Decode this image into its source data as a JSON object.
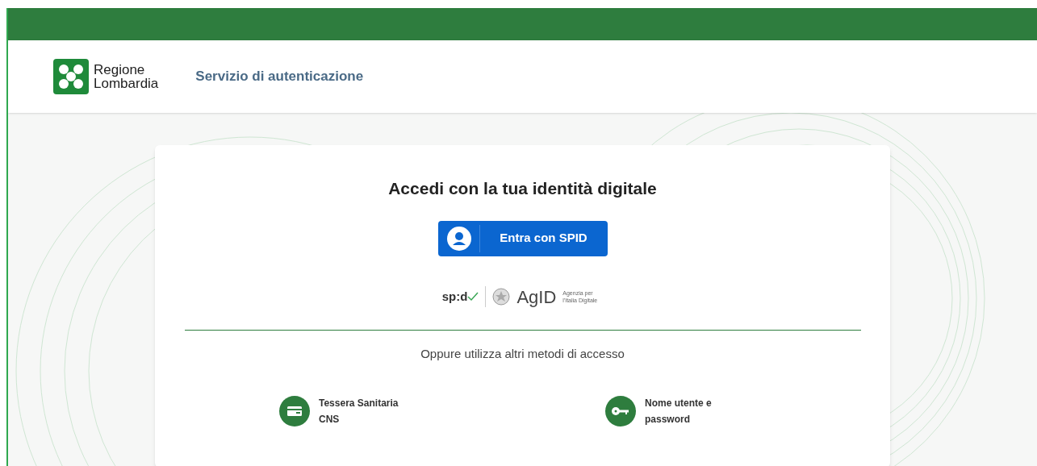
{
  "header": {
    "logo_text": [
      "Regione",
      "Lombardia"
    ],
    "service_title": "Servizio di autenticazione"
  },
  "card": {
    "title": "Accedi con la tua identità digitale",
    "spid_button": "Entra con SPID",
    "partner_logos": {
      "spid": "sp:d",
      "agid": "AgID",
      "agid_caption": "Agenzia per l'Italia Digitale"
    },
    "divider_text": "Oppure utilizza altri metodi di accesso",
    "methods": [
      {
        "kind": "card",
        "label": "Tessera Sanitaria CNS"
      },
      {
        "kind": "key",
        "label": "Nome utente e password"
      }
    ]
  }
}
